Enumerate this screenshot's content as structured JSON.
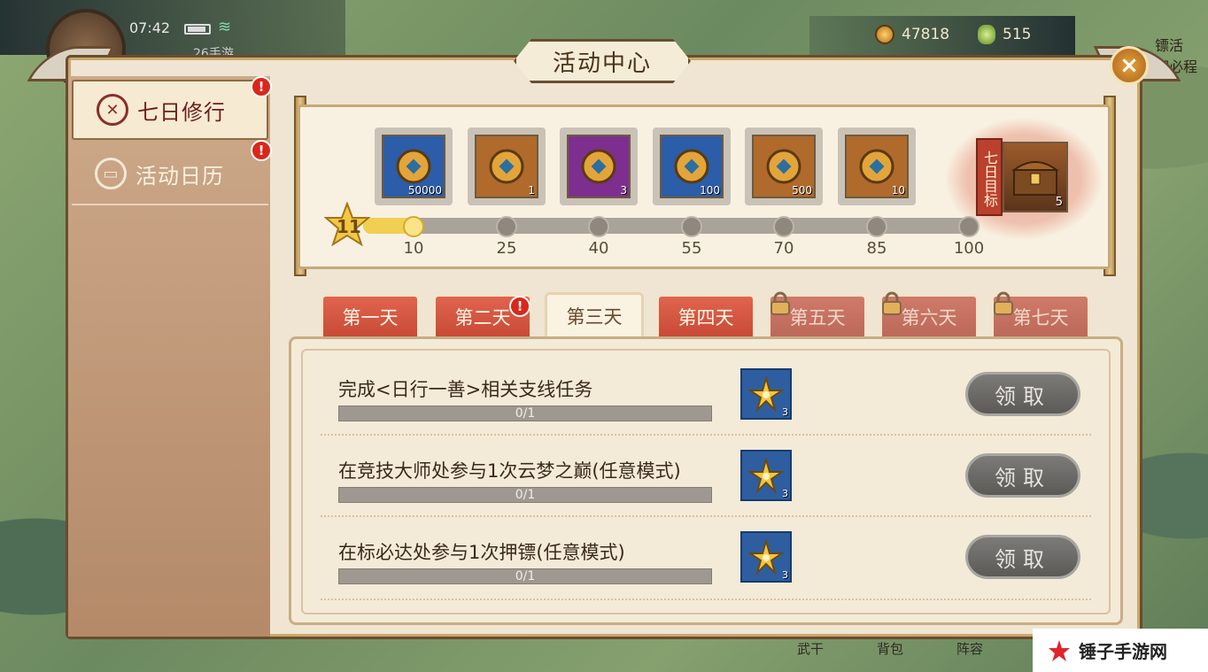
{
  "status_bar": {
    "time": "07:42",
    "site_tag": "26手游"
  },
  "resources": {
    "coins": "47818",
    "jade": "515"
  },
  "corner_right": {
    "line1": "镖活",
    "line2": "解必程"
  },
  "header": {
    "title": "活动中心",
    "close_label": "×"
  },
  "sidebar": {
    "items": [
      {
        "label": "七日修行",
        "icon": "seven-day-icon",
        "active": true,
        "alert": "!"
      },
      {
        "label": "活动日历",
        "icon": "calendar-icon",
        "active": false,
        "alert": "!"
      }
    ]
  },
  "progress": {
    "current": "11",
    "milestones": [
      "10",
      "25",
      "40",
      "55",
      "70",
      "85",
      "100"
    ],
    "current_value": 11,
    "max_value": 100,
    "rewards": [
      {
        "name": "coin",
        "qty": "50000",
        "color": "#2b5da8",
        "icon": "copper-coin-icon"
      },
      {
        "name": "hero-card",
        "qty": "1",
        "color": "#b06a2b",
        "icon": "hero-portrait-icon"
      },
      {
        "name": "gift-bag",
        "qty": "3",
        "color": "#7d2f8f",
        "icon": "gift-bag-icon"
      },
      {
        "name": "crystal",
        "qty": "100",
        "color": "#2b5da8",
        "icon": "crystal-icon"
      },
      {
        "name": "jade-token",
        "qty": "500",
        "color": "#b06a2b",
        "icon": "jade-icon"
      },
      {
        "name": "treasure-chest",
        "qty": "10",
        "color": "#b06a2b",
        "icon": "chest-icon"
      }
    ],
    "goal_label": "七日目标",
    "goal_qty": "5"
  },
  "tabs": [
    {
      "label": "第一天",
      "state": "red"
    },
    {
      "label": "第二天",
      "state": "red",
      "alert": "!"
    },
    {
      "label": "第三天",
      "state": "selected"
    },
    {
      "label": "第四天",
      "state": "red"
    },
    {
      "label": "第五天",
      "state": "locked"
    },
    {
      "label": "第六天",
      "state": "locked"
    },
    {
      "label": "第七天",
      "state": "locked"
    }
  ],
  "tasks": [
    {
      "title": "完成<日行一善>相关支线任务",
      "progress": "0/1",
      "reward_qty": "3",
      "claim": "领取"
    },
    {
      "title": "在竞技大师处参与1次云梦之巅(任意模式)",
      "progress": "0/1",
      "reward_qty": "3",
      "claim": "领取"
    },
    {
      "title": "在标必达处参与1次押镖(任意模式)",
      "progress": "0/1",
      "reward_qty": "3",
      "claim": "领取"
    }
  ],
  "bottom_nav": [
    "武干",
    "背包",
    "阵容"
  ],
  "watermark": "锤子手游网"
}
